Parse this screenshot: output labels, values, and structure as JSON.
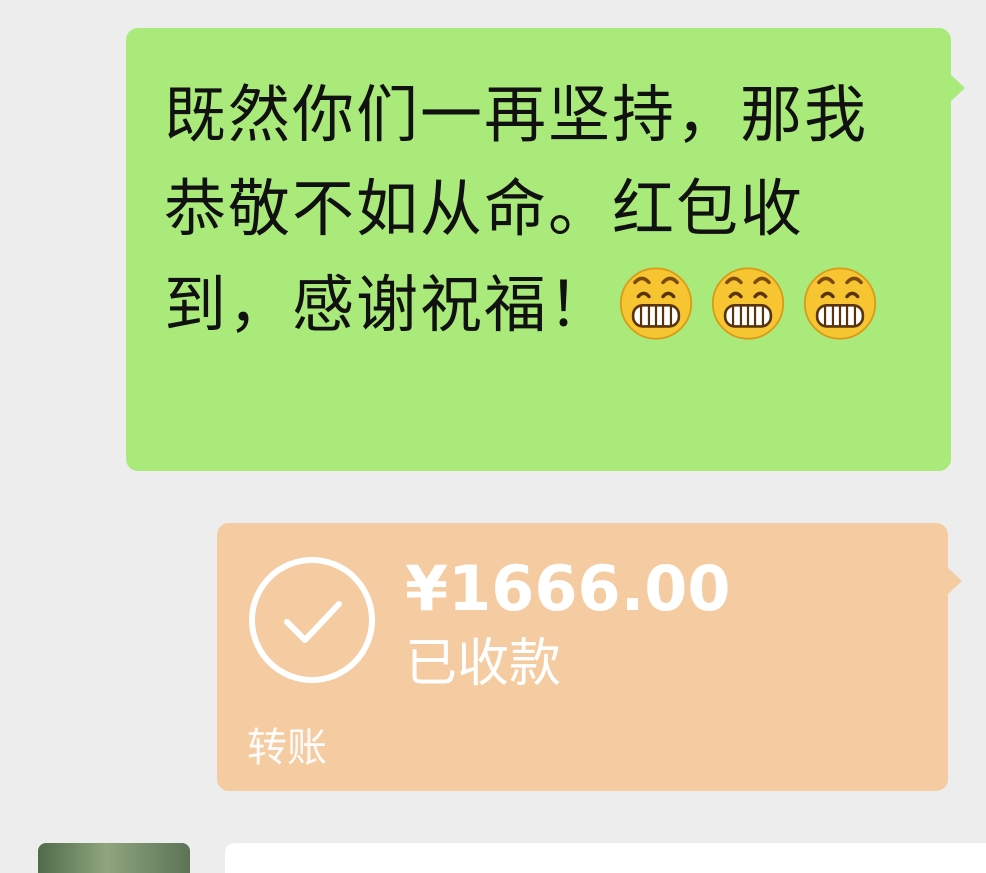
{
  "messages": {
    "text_bubble": {
      "text": "既然你们一再坚持，那我恭敬不如从命。红包收到，感谢祝福！",
      "emojis": [
        "grin-emoji",
        "grin-emoji",
        "grin-emoji"
      ],
      "background": "#a9ea7a"
    },
    "transfer": {
      "amount": "¥1666.00",
      "status": "已收款",
      "label": "转账",
      "icon": "check-circle-icon",
      "background": "#f5cca1"
    }
  },
  "chat_background": "#ededed"
}
